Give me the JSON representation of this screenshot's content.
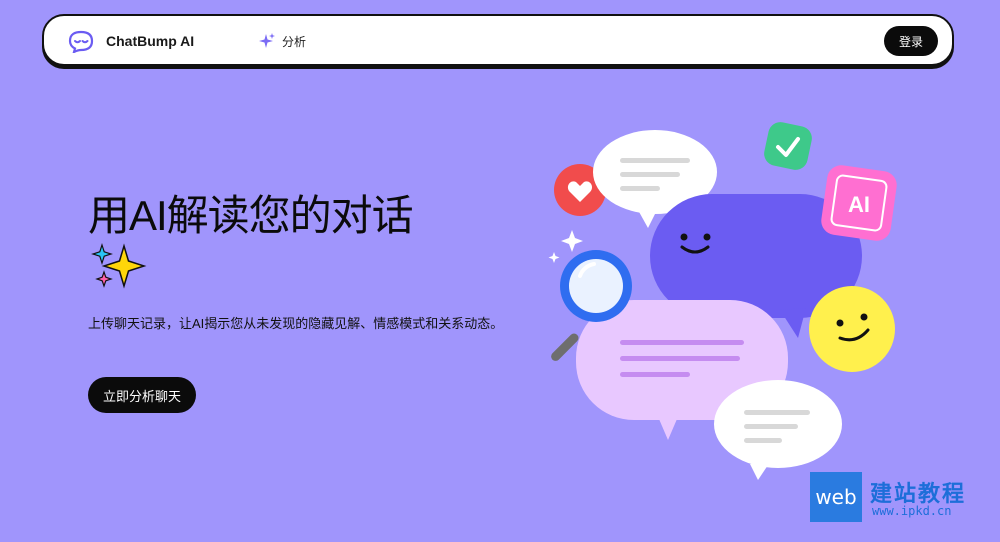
{
  "navbar": {
    "brand": "ChatBump AI",
    "nav_items": [
      {
        "label": "分析",
        "icon": "sparkle-icon"
      }
    ],
    "login_label": "登录"
  },
  "hero": {
    "title": "用AI解读您的对话",
    "description": "上传聊天记录，让AI揭示您从未发现的隐藏见解、情感模式和关系动态。",
    "cta_label": "立即分析聊天"
  },
  "illustration": {
    "badge_text": "AI",
    "icons": [
      "heart-icon",
      "check-icon",
      "ai-badge-icon",
      "magnifier-icon",
      "smiley-icon"
    ]
  },
  "watermark": {
    "logo_text": "web",
    "title": "建站教程",
    "url": "www.ipkd.cn"
  },
  "colors": {
    "background": "#a095fc",
    "accent": "#6b5cf2",
    "button": "#0b0b0b"
  }
}
